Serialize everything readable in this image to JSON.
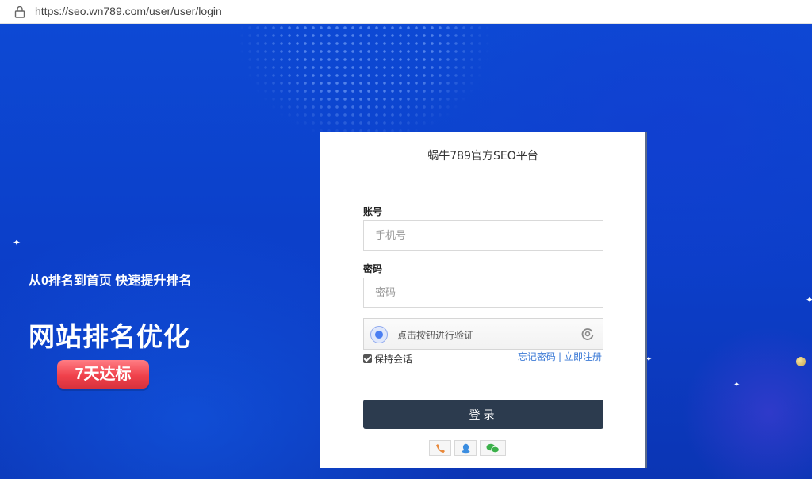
{
  "browser": {
    "url": "https://seo.wn789.com/user/user/login"
  },
  "promo": {
    "subtitle": "从0排名到首页 快速提升排名",
    "title": "网站排名优化",
    "badge": "7天达标"
  },
  "login": {
    "title": "蜗牛789官方SEO平台",
    "account_label": "账号",
    "account_placeholder": "手机号",
    "password_label": "密码",
    "password_placeholder": "密码",
    "verify_text": "点击按钮进行验证",
    "remember_label": "保持会话",
    "forgot_link": "忘记密码",
    "link_separator": "|",
    "register_link": "立即注册",
    "submit_label": "登录",
    "social": [
      {
        "icon": "phone-icon",
        "color": "#e8883a"
      },
      {
        "icon": "qq-icon",
        "color": "#3b8de0"
      },
      {
        "icon": "wechat-icon",
        "color": "#3bb04a"
      }
    ]
  },
  "colors": {
    "hero_blue": "#0d49d4",
    "submit_bg": "#2c3b4e",
    "link": "#3d7bd6",
    "badge_red": "#f0414b"
  }
}
